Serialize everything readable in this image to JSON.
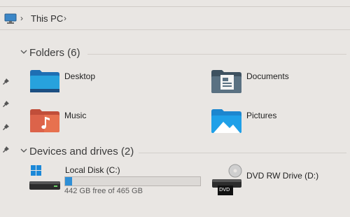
{
  "breadcrumb": {
    "location": "This PC"
  },
  "groups": {
    "folders": {
      "title": "Folders (6)"
    },
    "devices": {
      "title": "Devices and drives (2)"
    }
  },
  "folders": [
    {
      "label": "Desktop",
      "icon": "desktop-folder-icon"
    },
    {
      "label": "Documents",
      "icon": "documents-folder-icon"
    },
    {
      "label": "Music",
      "icon": "music-folder-icon"
    },
    {
      "label": "Pictures",
      "icon": "pictures-folder-icon"
    }
  ],
  "drives": [
    {
      "label": "Local Disk (C:)",
      "free_text": "442 GB free of 465 GB",
      "used_fraction": 0.05,
      "icon": "windows-drive-icon"
    },
    {
      "label": "DVD RW Drive (D:)",
      "badge": "DVD",
      "icon": "dvd-drive-icon"
    }
  ],
  "colors": {
    "accent": "#2e8fd6",
    "background": "#e9e6e3"
  }
}
